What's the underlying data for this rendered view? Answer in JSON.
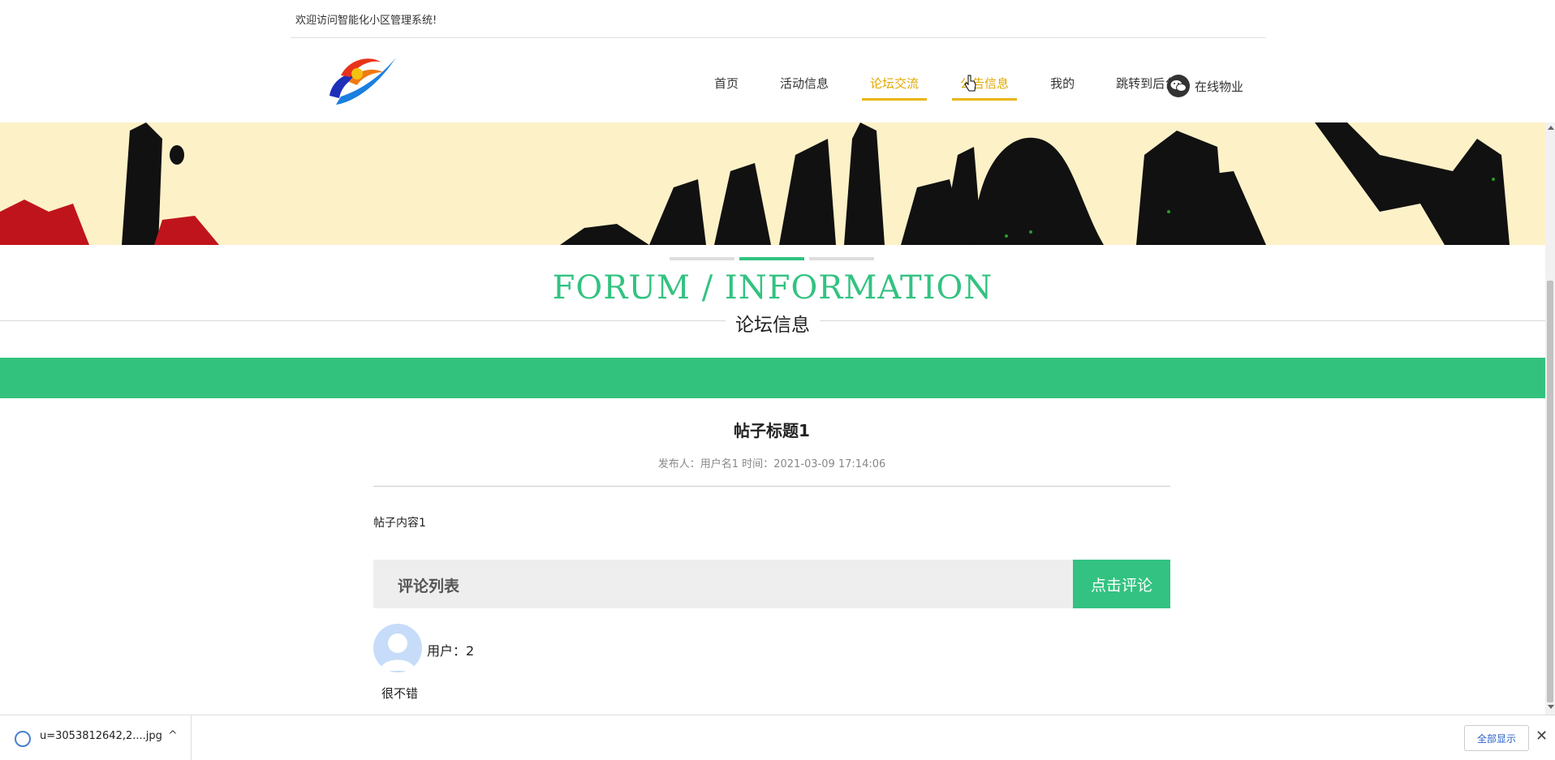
{
  "topbar": {
    "welcome": "欢迎访问智能化小区管理系统!"
  },
  "nav": {
    "items": [
      {
        "label": "首页"
      },
      {
        "label": "活动信息"
      },
      {
        "label": "论坛交流"
      },
      {
        "label": "公告信息"
      },
      {
        "label": "我的"
      },
      {
        "label": "跳转到后台"
      }
    ],
    "active_index": 2,
    "wechat_label": "在线物业"
  },
  "section": {
    "title_en": "FORUM / INFORMATION",
    "title_cn": "论坛信息"
  },
  "post": {
    "title": "帖子标题1",
    "author_label": "发布人：",
    "author": "用户名1",
    "time_label": "时间：",
    "time": "2021-03-09 17:14:06",
    "body": "帖子内容1"
  },
  "comments": {
    "header": "评论列表",
    "button": "点击评论",
    "items": [
      {
        "user_label": "用户：",
        "user": "2",
        "text": "很不错"
      }
    ]
  },
  "download_bar": {
    "file": "u=3053812642,2....jpg",
    "show_all": "全部显示"
  },
  "colors": {
    "brand_green": "#33c27d",
    "nav_active": "#e0a800",
    "banner_bg": "#fdf1c8"
  }
}
